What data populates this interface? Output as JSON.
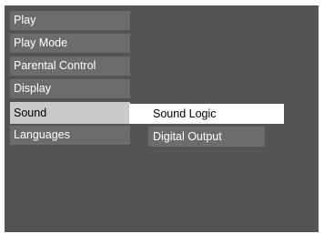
{
  "menu": {
    "items": [
      {
        "label": "Play"
      },
      {
        "label": "Play Mode"
      },
      {
        "label": "Parental Control"
      },
      {
        "label": "Display"
      },
      {
        "label": "Sound"
      },
      {
        "label": "Languages"
      }
    ],
    "selected": "Sound"
  },
  "submenu": {
    "items": [
      {
        "label": "Sound Logic"
      },
      {
        "label": "Digital Output"
      }
    ],
    "highlighted": "Sound Logic"
  }
}
